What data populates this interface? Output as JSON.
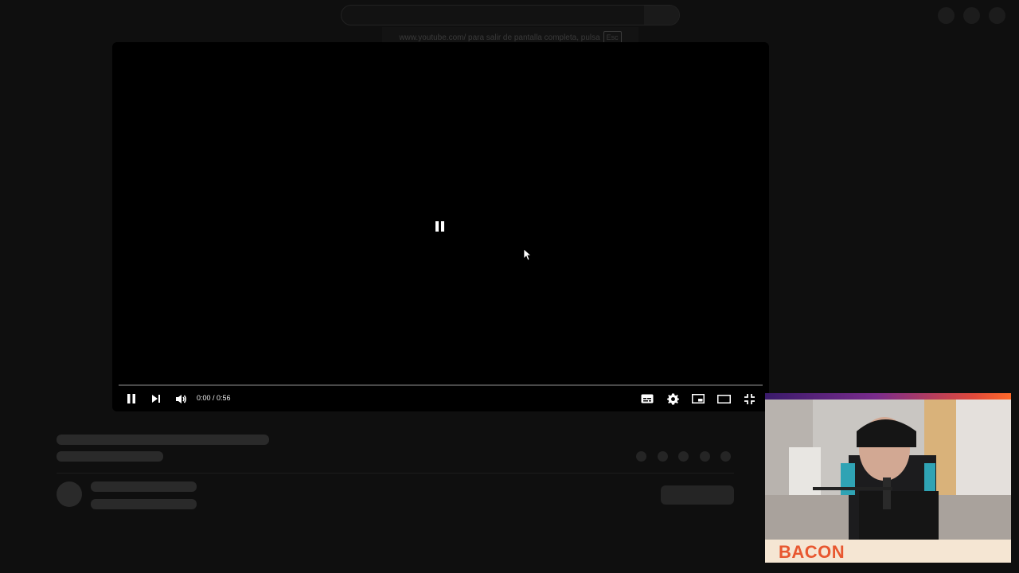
{
  "browser": {
    "fullscreen_notice": "www.youtube.com/ para salir de pantalla completa, pulsa",
    "esc_key": "Esc"
  },
  "player": {
    "time_display": "0:00 / 0:56",
    "progress": 0.0,
    "state": "paused",
    "controls": {
      "left": [
        "pause-icon",
        "next-icon",
        "volume-icon"
      ],
      "right": [
        "subtitles-icon",
        "settings-icon",
        "miniplayer-icon",
        "theater-mode-icon",
        "fullscreen-icon"
      ]
    }
  },
  "webcam": {
    "streamer_name": "BACON",
    "accent_colors": [
      "#3a1b6b",
      "#7a2c8c",
      "#e04a3b",
      "#ff6a2a"
    ],
    "name_color": "#e8572f",
    "name_bg": "#f5e6d3"
  },
  "theme": {
    "background": "#0f0f0f",
    "skeleton": "#2a2a2a"
  }
}
